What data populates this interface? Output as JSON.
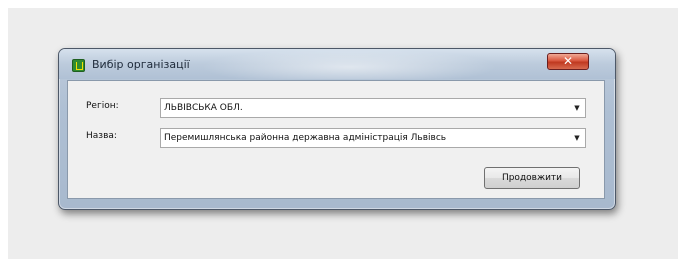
{
  "window": {
    "title": "Вибір організації",
    "close_glyph": "✕",
    "app_icon": "app-tryzub-icon"
  },
  "form": {
    "region_label": "Регіон:",
    "region_value": "ЛЬВІВСЬКА ОБЛ.",
    "name_label": "Назва:",
    "name_value": "Перемишлянська районна державна адміністрація Львівсь",
    "dropdown_glyph": "▼",
    "continue_button": "Продовжити"
  },
  "colors": {
    "close_button": "#c03920",
    "window_frame": "#a8b9ce",
    "client_area": "#f0f0f0"
  }
}
